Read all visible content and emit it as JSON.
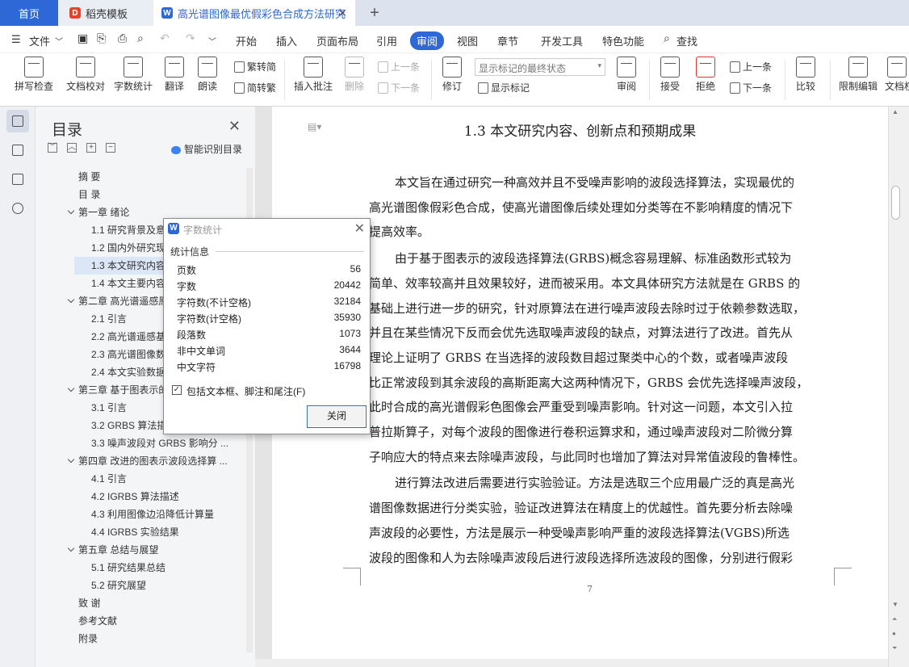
{
  "tabs": {
    "home": "首页",
    "template": "稻壳模板",
    "document": "高光谱图像最优假彩色合成方法研究"
  },
  "menu": {
    "file": "文件",
    "items": [
      "开始",
      "插入",
      "页面布局",
      "引用",
      "审阅",
      "视图",
      "章节",
      "开发工具",
      "特色功能"
    ],
    "search": "查找"
  },
  "ribbon": {
    "spellcheck": "拼写检查",
    "proofread": "文档校对",
    "wordcount": "字数统计",
    "translate": "翻译",
    "read": "朗读",
    "trad": "繁转简",
    "simp": "简转繁",
    "insert_comment": "插入批注",
    "delete": "删除",
    "prev_comment": "上一条",
    "next_comment": "下一条",
    "track": "修订",
    "markup_select": "显示标记的最终状态",
    "show_markup": "显示标记",
    "review": "审阅",
    "accept": "接受",
    "reject": "拒绝",
    "prev_change": "上一条",
    "next_change": "下一条",
    "compare": "比较",
    "restrict": "限制编辑",
    "doc_cut": "文档权"
  },
  "toc": {
    "title": "目录",
    "smart": "智能识别目录",
    "items": [
      {
        "text": "摘 要",
        "level": 0
      },
      {
        "text": "目 录",
        "level": 0
      },
      {
        "text": "第一章 绪论",
        "level": 0,
        "arrow": true
      },
      {
        "text": "1.1 研究背景及意",
        "level": 1
      },
      {
        "text": "1.2 国内外研究现",
        "level": 1
      },
      {
        "text": "1.3 本文研究内容",
        "level": 1,
        "sel": true
      },
      {
        "text": "1.4 本文主要内容",
        "level": 1
      },
      {
        "text": "第二章 高光谱遥感原",
        "level": 0,
        "arrow": true
      },
      {
        "text": "2.1 引言",
        "level": 1
      },
      {
        "text": "2.2 高光谱遥感基",
        "level": 1
      },
      {
        "text": "2.3 高光谱图像数",
        "level": 1
      },
      {
        "text": "2.4 本文实验数据",
        "level": 1
      },
      {
        "text": "第三章 基于图表示的",
        "level": 0,
        "arrow": true
      },
      {
        "text": "3.1 引言",
        "level": 1
      },
      {
        "text": "3.2 GRBS 算法描",
        "level": 1
      },
      {
        "text": "3.3 噪声波段对 GRBS 影响分 ...",
        "level": 1
      },
      {
        "text": "第四章 改进的图表示波段选择算 ...",
        "level": 0,
        "arrow": true
      },
      {
        "text": "4.1 引言",
        "level": 1
      },
      {
        "text": "4.2 IGRBS 算法描述",
        "level": 1
      },
      {
        "text": "4.3 利用图像边沿降低计算量",
        "level": 1
      },
      {
        "text": "4.4 IGRBS 实验结果",
        "level": 1
      },
      {
        "text": "第五章 总结与展望",
        "level": 0,
        "arrow": true
      },
      {
        "text": "5.1 研究结果总结",
        "level": 1
      },
      {
        "text": "5.2 研究展望",
        "level": 1
      },
      {
        "text": "致 谢",
        "level": 0
      },
      {
        "text": "参考文献",
        "level": 0
      },
      {
        "text": "附录",
        "level": 0
      }
    ]
  },
  "doc": {
    "heading": "1.3 本文研究内容、创新点和预期成果",
    "page_number": "7",
    "lines": [
      {
        "t": "本文旨在通过研究一种高效并且不受噪声影响的波段选择算法，实现最优的",
        "indent": true
      },
      {
        "t": "高光谱图像假彩色合成，使高光谱图像后续处理如分类等在不影响精度的情况下"
      },
      {
        "t": "提高效率。"
      },
      {
        "t": "由于基于图表示的波段选择算法(GRBS)概念容易理解、标准函数形式较为",
        "indent": true
      },
      {
        "t": "简单、效率较高并且效果较好，进而被采用。本文具体研究方法就是在 GRBS 的"
      },
      {
        "t": "基础上进行进一步的研究，针对原算法在进行噪声波段去除时过于依赖参数选取，"
      },
      {
        "t": "并且在某些情况下反而会优先选取噪声波段的缺点，对算法进行了改进。首先从"
      },
      {
        "t": "理论上证明了 GRBS 在当选择的波段数目超过聚类中心的个数，或者噪声波段"
      },
      {
        "t": "比正常波段到其余波段的高斯距离大这两种情况下，GRBS 会优先选择噪声波段，"
      },
      {
        "t": "此时合成的高光谱假彩色图像会严重受到噪声影响。针对这一问题，本文引入拉"
      },
      {
        "t": "普拉斯算子，对每个波段的图像进行卷积运算求和，通过噪声波段对二阶微分算"
      },
      {
        "t": "子响应大的特点来去除噪声波段，与此同时也增加了算法对异常值波段的鲁棒性。"
      },
      {
        "t": "进行算法改进后需要进行实验验证。方法是选取三个应用最广泛的真是高光",
        "indent": true
      },
      {
        "t": "谱图像数据进行分类实验，验证改进算法在精度上的优越性。首先要分析去除噪"
      },
      {
        "t": "声波段的必要性，方法是展示一种受噪声影响严重的波段选择算法(VGBS)所选"
      },
      {
        "t": "波段的图像和人为去除噪声波段后进行波段选择所选波段的图像，分别进行假彩"
      }
    ]
  },
  "dialog": {
    "title": "字数统计",
    "section": "统计信息",
    "stats": [
      {
        "label": "页数",
        "value": "56"
      },
      {
        "label": "字数",
        "value": "20442"
      },
      {
        "label": "字符数(不计空格)",
        "value": "32184"
      },
      {
        "label": "字符数(计空格)",
        "value": "35930"
      },
      {
        "label": "段落数",
        "value": "1073"
      },
      {
        "label": "非中文单词",
        "value": "3644"
      },
      {
        "label": "中文字符",
        "value": "16798"
      }
    ],
    "checkbox": "包括文本框、脚注和尾注(F)",
    "checked": true,
    "close": "关闭"
  }
}
